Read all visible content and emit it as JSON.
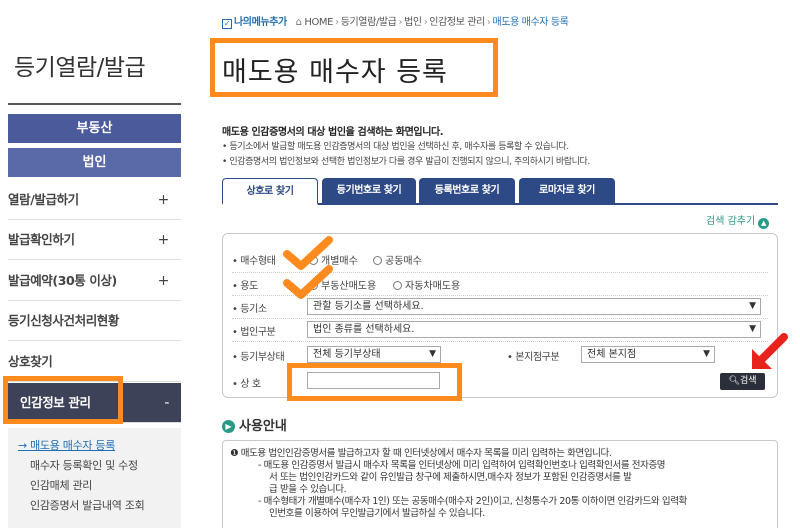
{
  "breadcrumb": {
    "mymenu": "나의메뉴추가",
    "items": [
      "HOME",
      "등기열람/발급",
      "법인",
      "인감정보 관리",
      "매도용 매수자 등록"
    ]
  },
  "sidebar": {
    "title": "등기열람/발급",
    "btn_property": "부동산",
    "btn_corp": "법인",
    "items": [
      {
        "label": "열람/발급하기",
        "plus": "+"
      },
      {
        "label": "발급확인하기",
        "plus": "+"
      },
      {
        "label": "발급예약(30통 이상)",
        "plus": "+"
      },
      {
        "label": "등기신청사건처리현황",
        "plus": ""
      },
      {
        "label": "상호찾기",
        "plus": ""
      },
      {
        "label": "인감정보 관리",
        "plus": "-"
      }
    ],
    "sub_items": [
      "→ 매도용 매수자 등록",
      "매수자 등록확인 및 수정",
      "인감매체 관리",
      "인감증명서 발급내역 조회"
    ]
  },
  "main": {
    "title": "매도용 매수자 등록",
    "desc_head": "매도용 인감증명서의 대상 법인을 검색하는 화면입니다.",
    "desc_lines": [
      "• 등기소에서 발급할 매도용 인감증명서의 대상 법인을 선택하신 후, 매수자를 등록할 수 있습니다.",
      "• 인감증명서의 법인정보와 선택한 법인정보가 다를 경우 발급이 진행되지 않으니, 주의하시기 바랍니다."
    ],
    "tabs": [
      "상호로 찾기",
      "등기번호로 찾기",
      "등록번호로 찾기",
      "로마자로 찾기"
    ],
    "collapse_label": "검색 감추기",
    "form": {
      "buyer_type_label": "• 매수형태",
      "buyer_type_options": [
        "개별매수",
        "공동매수"
      ],
      "purpose_label": "• 용도",
      "purpose_options": [
        "부동산매도용",
        "자동차매도용"
      ],
      "office_label": "• 등기소",
      "office_value": "관할 등기소를 선택하세요.",
      "corp_class_label": "• 법인구분",
      "corp_class_value": "법인 종류를 선택하세요.",
      "status_label": "• 등기부상태",
      "status_value": "전체 등기부상태",
      "branch_label": "• 본지점구분",
      "branch_value": "전체 본지점",
      "name_label": "• 상 호",
      "name_value": "",
      "search_button": "검색"
    },
    "usage": {
      "title": "사용안내",
      "lines": [
        "❶ 매도용 법인인감증명서를 발급하고자 할 때 인터넷상에서 매수자 목록을 미리 입력하는 화면입니다.",
        "- 매도용 인감증명서 발급시 매수자 목록을 인터넷상에 미리 입력하여 입력확인번호나 입력확인서를 전자증명",
        "서 또는 법인인감카드와 같이 유인발급 창구에 제출하시면,매수자 정보가 포함된 인감증명서를 발",
        "급 받을 수 있습니다.",
        "- 매수형태가 개별매수(매수자 1인) 또는 공동매수(매수자 2인)이고, 신청통수가 20통 이하이면 인감카드와 입력확",
        "인번호를 이용하여 무인발급기에서 발급하실 수 있습니다."
      ]
    }
  },
  "colors": {
    "accent_navy": "#2e4a86",
    "highlight_orange": "#ff8a1d",
    "arrow_red": "#e8231c",
    "teal": "#2a9a88"
  }
}
